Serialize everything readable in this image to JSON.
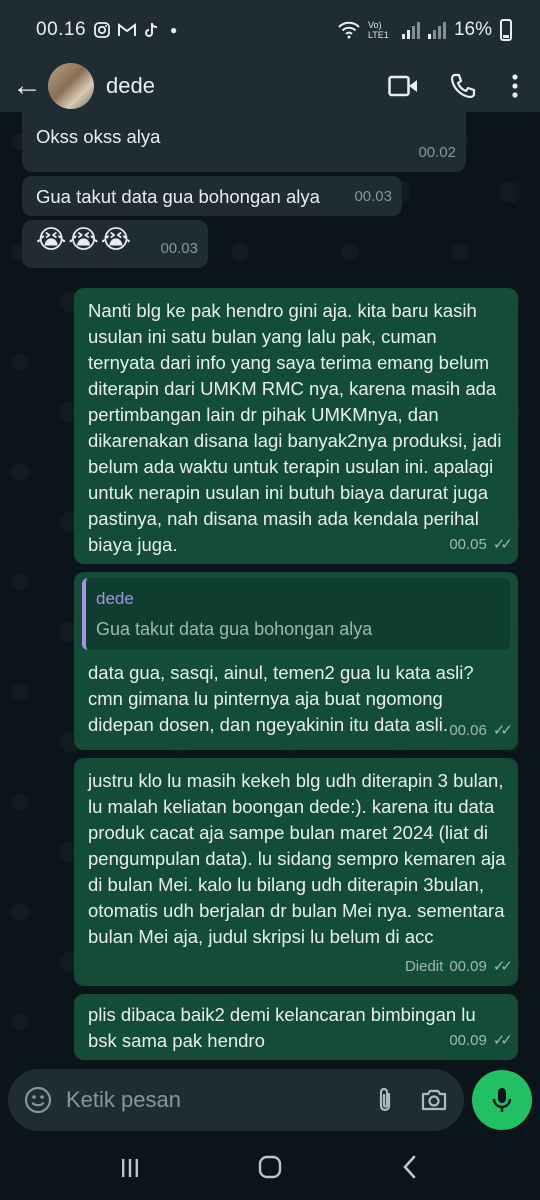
{
  "status_bar": {
    "time": "00.16",
    "icons": [
      "instagram-icon",
      "gmail-icon",
      "tiktok-icon",
      "dot"
    ],
    "network": "Vo) LTE1",
    "battery": "16%"
  },
  "header": {
    "contact_name": "dede",
    "back_icon": "arrow-left-icon",
    "actions": [
      "video-call-icon",
      "voice-call-icon",
      "more-icon"
    ]
  },
  "messages": [
    {
      "dir": "in",
      "text": "Okss okss alya",
      "time": "00.02"
    },
    {
      "dir": "in",
      "text": "Gua takut data gua bohongan alya",
      "time": "00.03"
    },
    {
      "dir": "in",
      "text": "😭😭😭",
      "time": "00.03"
    },
    {
      "dir": "out",
      "text": "Nanti blg ke pak hendro gini aja. kita baru kasih usulan ini satu bulan yang lalu pak, cuman ternyata dari info yang saya terima emang belum diterapin dari UMKM RMC nya, karena masih ada pertimbangan lain dr pihak UMKMnya, dan dikarenakan disana lagi banyak2nya produksi, jadi belum ada waktu untuk terapin usulan ini. apalagi untuk nerapin usulan ini butuh biaya darurat juga pastinya, nah disana masih ada kendala perihal biaya juga.",
      "time": "00.05"
    },
    {
      "dir": "out",
      "quote_name": "dede",
      "quote_text": "Gua takut data gua bohongan alya",
      "text": "data gua, sasqi, ainul, temen2 gua lu kata asli? cmn gimana lu pinternya aja buat ngomong didepan dosen, dan ngeyakinin itu data asli.",
      "time": "00.06"
    },
    {
      "dir": "out",
      "text": "justru klo lu masih kekeh blg udh diterapin 3 bulan, lu malah keliatan boongan dede:). karena itu data produk cacat aja sampe bulan maret 2024 (liat di pengumpulan data). lu sidang sempro kemaren aja di bulan Mei. kalo lu bilang udh diterapin 3bulan, otomatis udh berjalan dr bulan Mei nya. sementara bulan Mei aja, judul skripsi lu belum di acc",
      "edited": "Diedit",
      "time": "00.09"
    },
    {
      "dir": "out",
      "text": "plis dibaca baik2 demi kelancaran bimbingan lu bsk sama pak hendro",
      "time": "00.09"
    }
  ],
  "composer": {
    "placeholder": "Ketik pesan",
    "icons": [
      "emoji-icon",
      "attach-icon",
      "camera-icon",
      "mic-icon"
    ]
  },
  "nav": [
    "recents-icon",
    "home-icon",
    "back-nav-icon"
  ]
}
